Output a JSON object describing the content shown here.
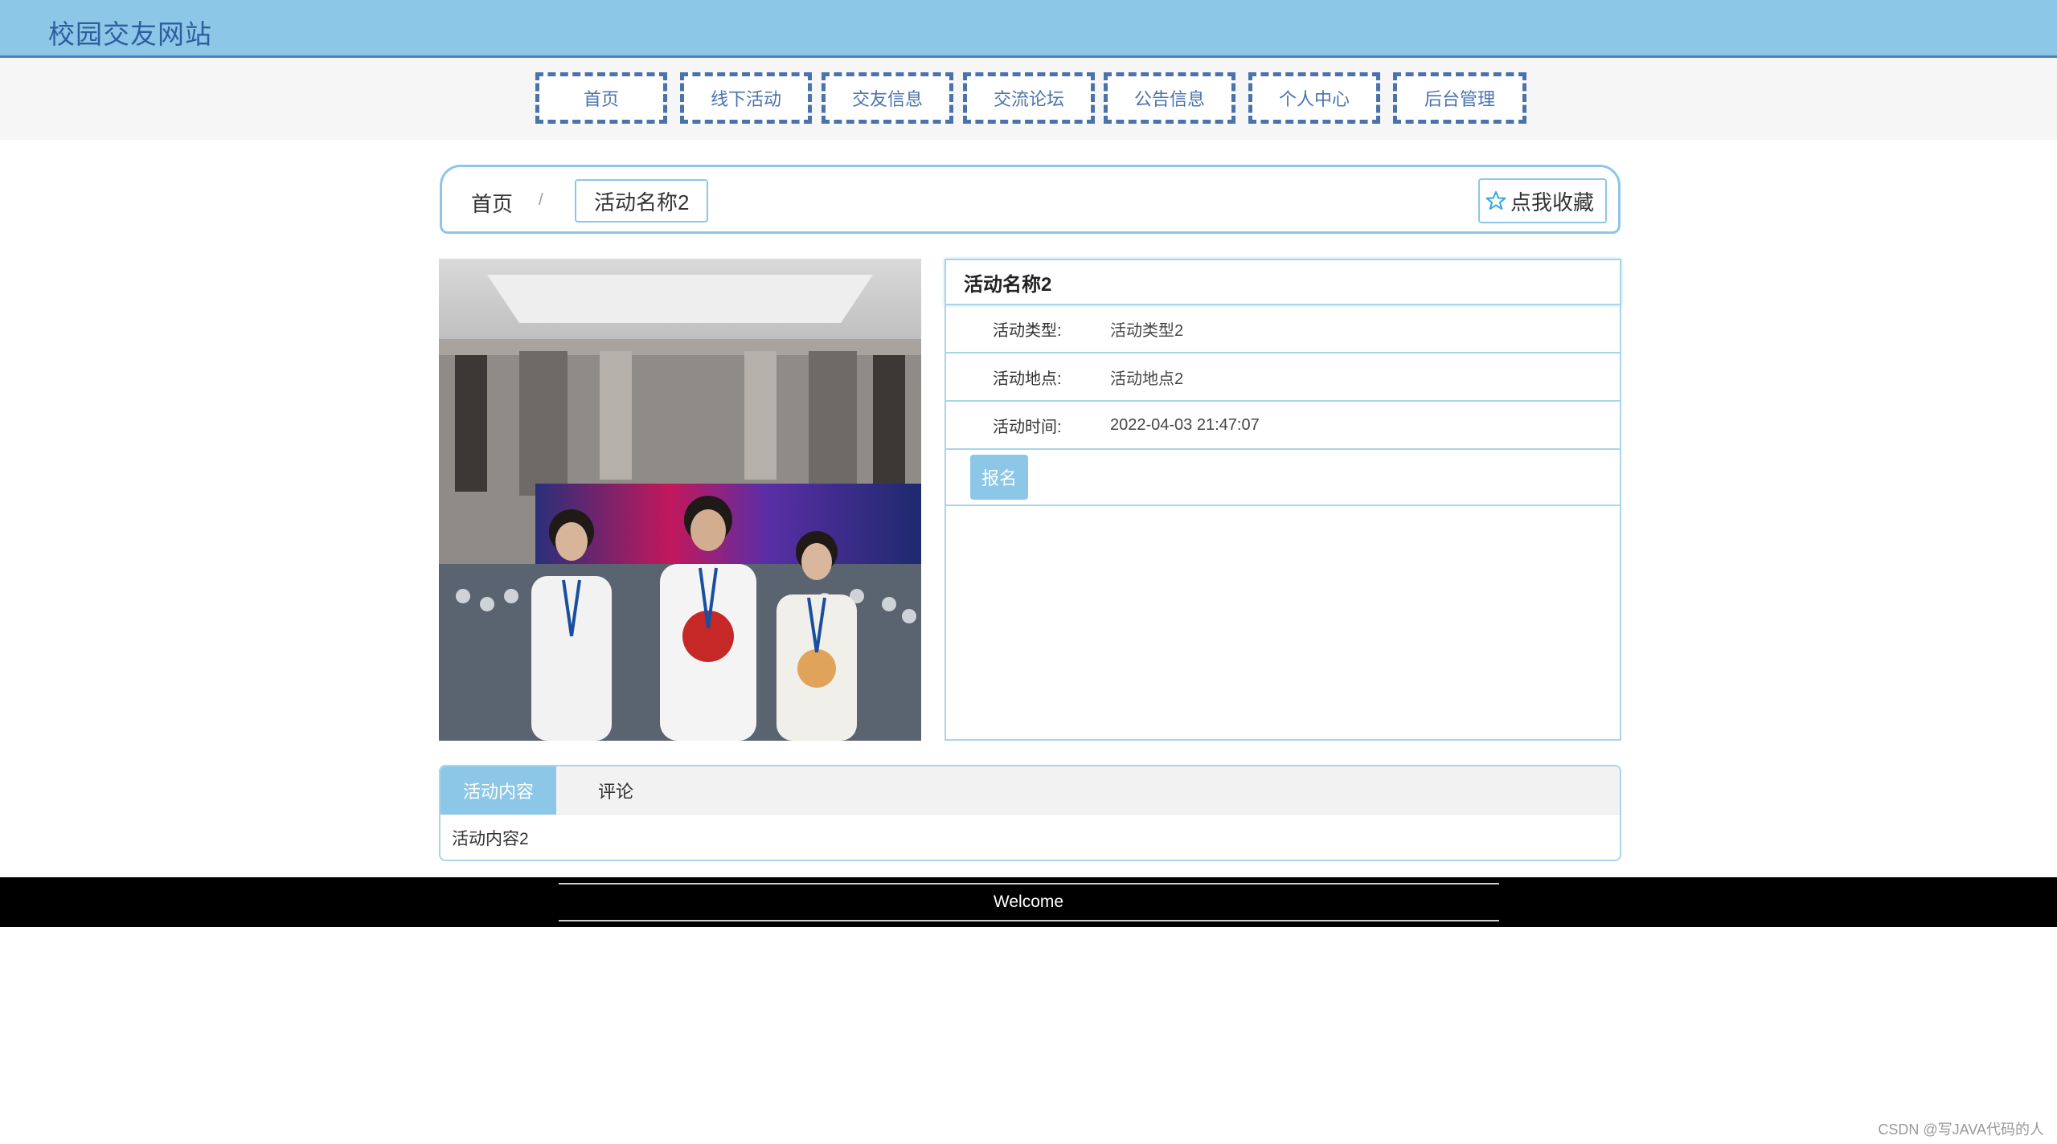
{
  "header": {
    "site_title": "校园交友网站"
  },
  "nav": {
    "items": [
      {
        "label": "首页"
      },
      {
        "label": "线下活动"
      },
      {
        "label": "交友信息"
      },
      {
        "label": "交流论坛"
      },
      {
        "label": "公告信息"
      },
      {
        "label": "个人中心"
      },
      {
        "label": "后台管理"
      }
    ]
  },
  "breadcrumb": {
    "home": "首页",
    "separator": "/",
    "current": "活动名称2",
    "favorite_label": "点我收藏"
  },
  "detail": {
    "title": "活动名称2",
    "rows": [
      {
        "label": "活动类型:",
        "value": "活动类型2"
      },
      {
        "label": "活动地点:",
        "value": "活动地点2"
      },
      {
        "label": "活动时间:",
        "value": "2022-04-03 21:47:07"
      }
    ],
    "signup_label": "报名"
  },
  "tabs": {
    "items": [
      {
        "label": "活动内容",
        "active": true
      },
      {
        "label": "评论",
        "active": false
      }
    ],
    "content": "活动内容2"
  },
  "footer": {
    "text": "Welcome"
  },
  "watermark": "CSDN @写JAVA代码的人",
  "colors": {
    "header_bg": "#8cc7e8",
    "brand_text": "#2f5e9e",
    "nav_border": "#4a73ad",
    "accent": "#8cc7e8",
    "footer_bg": "#000000"
  }
}
